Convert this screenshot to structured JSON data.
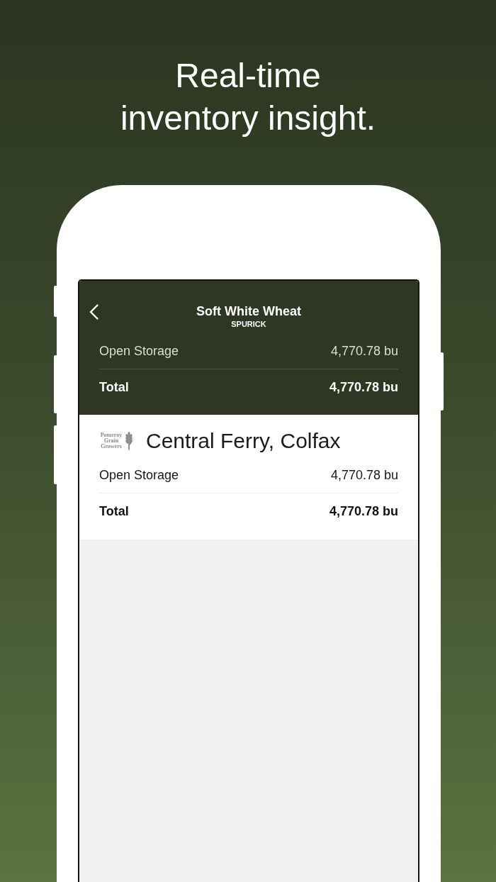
{
  "headline": "Real-time inventory insight.",
  "screen": {
    "nav": {
      "title": "Soft White Wheat",
      "subtitle": "SPURICK"
    },
    "summary": [
      {
        "kind": "item",
        "label": "Open Storage",
        "value": "4,770.78 bu"
      },
      {
        "kind": "total",
        "label": "Total",
        "value": "4,770.78 bu"
      }
    ],
    "locations": [
      {
        "logo_text": "Pomeroy Grain Growers",
        "name": "Central Ferry, Colfax",
        "rows": [
          {
            "kind": "item",
            "label": "Open Storage",
            "value": "4,770.78 bu"
          },
          {
            "kind": "total",
            "label": "Total",
            "value": "4,770.78 bu"
          }
        ]
      }
    ]
  }
}
